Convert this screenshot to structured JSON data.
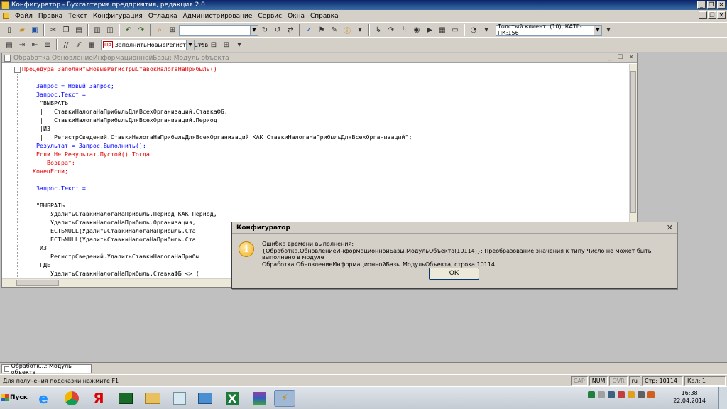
{
  "window": {
    "title": "Конфигуратор - Бухгалтерия предприятия, редакция 2.0",
    "min_btn": "_",
    "max_btn": "❐",
    "close_btn": "✕"
  },
  "menu": [
    "Файл",
    "Правка",
    "Текст",
    "Конфигурация",
    "Отладка",
    "Администрирование",
    "Сервис",
    "Окна",
    "Справка"
  ],
  "toolbar": {
    "search_value": "",
    "client_combo": "Толстый клиент: (10), КАТЕ-ПК:156",
    "procedure_combo": "ЗаполнитьНовыеРегистрыСтав",
    "procedure_badge": "Пр"
  },
  "module_window": {
    "title": "Обработка ОбновлениеИнформационнойБазы: Модуль объекта",
    "collapse_glyph": "−",
    "lines": [
      {
        "t": "Процедура ЗаполнитьНовыеРегистрыСтавокНалогаНаПрибыль()",
        "c": "red"
      },
      {
        "t": "",
        "c": "black"
      },
      {
        "t": "    Запрос = Новый Запрос;",
        "c": "blue"
      },
      {
        "t": "    Запрос.Текст =",
        "c": "blue"
      },
      {
        "t": "     \"ВЫБРАТЬ",
        "c": "black"
      },
      {
        "t": "     |   СтавкиНалогаНаПрибыльДляВсехОрганизаций.СтавкаФБ,",
        "c": "black"
      },
      {
        "t": "     |   СтавкиНалогаНаПрибыльДляВсехОрганизаций.Период",
        "c": "black"
      },
      {
        "t": "     |ИЗ",
        "c": "black"
      },
      {
        "t": "     |   РегистрСведений.СтавкиНалогаНаПрибыльДляВсехОрганизаций КАК СтавкиНалогаНаПрибыльДляВсехОрганизаций\";",
        "c": "black"
      },
      {
        "t": "    Результат = Запрос.Выполнить();",
        "c": "blue"
      },
      {
        "t": "    Если Не Результат.Пустой() Тогда",
        "c": "red"
      },
      {
        "t": "       Возврат;",
        "c": "red"
      },
      {
        "t": "   КонецЕсли;",
        "c": "red"
      },
      {
        "t": "",
        "c": "black"
      },
      {
        "t": "    Запрос.Текст =",
        "c": "blue"
      },
      {
        "t": "",
        "c": "black"
      },
      {
        "t": "    \"ВЫБРАТЬ",
        "c": "black"
      },
      {
        "t": "    |   УдалитьСтавкиНалогаНаПрибыль.Период КАК Период,",
        "c": "black"
      },
      {
        "t": "    |   УдалитьСтавкиНалогаНаПрибыль.Организация,",
        "c": "black"
      },
      {
        "t": "    |   ЕСТЬNULL(УдалитьСтавкиНалогаНаПрибыль.Ста",
        "c": "black"
      },
      {
        "t": "    |   ЕСТЬNULL(УдалитьСтавкиНалогаНаПрибыль.Ста",
        "c": "black"
      },
      {
        "t": "    |ИЗ",
        "c": "black"
      },
      {
        "t": "    |   РегистрСведений.УдалитьСтавкиНалогаНаПрибы",
        "c": "black"
      },
      {
        "t": "    |ГДЕ",
        "c": "black"
      },
      {
        "t": "    |   УдалитьСтавкиНалогаНаПрибыль.СтавкаФБ <> (",
        "c": "black"
      }
    ]
  },
  "dialog": {
    "title": "Конфигуратор",
    "close": "✕",
    "icon_glyph": "i",
    "line1": "Ошибка времени выполнения:",
    "line2": "{Обработка.ОбновлениеИнформационнойБазы.МодульОбъекта(10114)}: Преобразование значения к типу Число не может быть выполнено в модуле",
    "line3": "Обработка.ОбновлениеИнформационнойБазы.МодульОбъекта, строка 10114.",
    "ok": "ОК"
  },
  "tabs": [
    "Обработк...: Модуль объекта"
  ],
  "status": {
    "hint": "Для получения подсказки нажмите F1",
    "cap": "CAP",
    "num": "NUM",
    "ovr": "OVR",
    "lang": "ru",
    "line": "Стр: 10114",
    "col": "Кол: 1"
  },
  "taskbar": {
    "start": "Пуск",
    "time": "16:38",
    "date": "22.04.2014"
  },
  "colors": {
    "code_red": "#e00000",
    "code_blue": "#0000ff",
    "title_bar": "#0a246a"
  }
}
